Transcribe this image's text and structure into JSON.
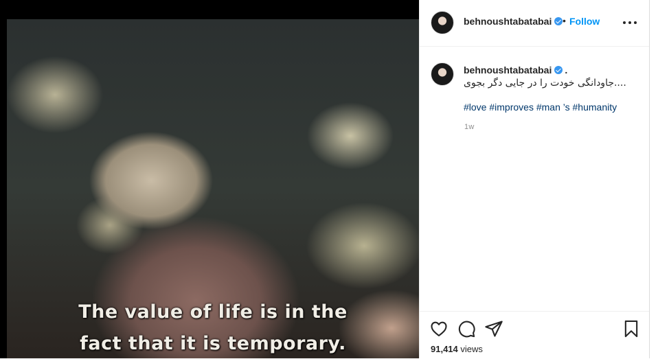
{
  "media": {
    "subtitle_line1": "The value of life is in the",
    "subtitle_line2": "fact that it is temporary."
  },
  "header": {
    "username": "behnoushtabatabai",
    "separator": "•",
    "follow_label": "Follow"
  },
  "caption": {
    "username": "behnoushtabatabai",
    "trailing": ".",
    "text": "جاودانگی خودت را در جایی دگر بجوی....",
    "hashtags": [
      "#love",
      "#improves",
      "#man",
      "’s",
      "#humanity"
    ],
    "time": "1w"
  },
  "stats": {
    "views_count": "91,414",
    "views_label": "views"
  },
  "icons": {
    "verified": "verified-badge-icon",
    "more": "more-options-icon",
    "like": "heart-icon",
    "comment": "comment-icon",
    "share": "share-icon",
    "save": "bookmark-icon"
  },
  "colors": {
    "accent": "#0095f6",
    "hashtag": "#00376b",
    "verified": "#3897f0"
  }
}
